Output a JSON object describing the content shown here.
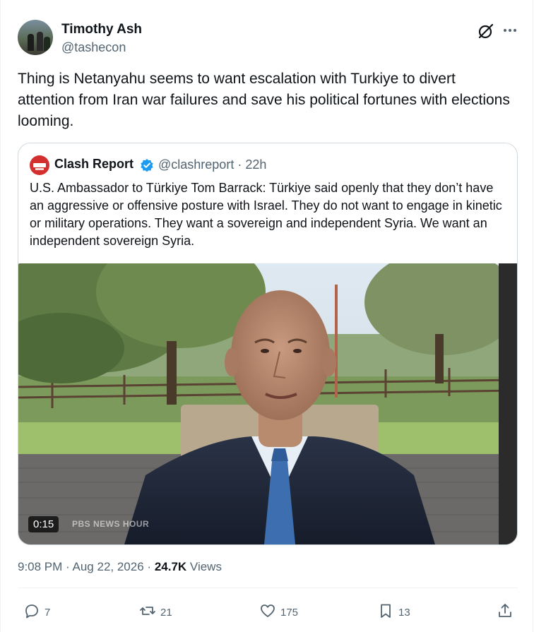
{
  "author": {
    "name": "Timothy Ash",
    "handle": "@tashecon"
  },
  "tweet": {
    "text": "Thing is Netanyahu seems to want escalation with Turkiye to divert attention from Iran war failures and save his political fortunes with elections looming."
  },
  "quoted": {
    "name": "Clash Report",
    "handle": "@clashreport",
    "separator": "·",
    "time": "22h",
    "text": "U.S. Ambassador to Türkiye Tom Barrack: Türkiye said openly that they don’t have an aggressive or offensive posture with Israel.  They do not want to engage in kinetic or military operations. They want a sovereign and independent Syria. We want an independent sovereign Syria.",
    "video": {
      "duration": "0:15",
      "watermark": "PBS NEWS HOUR"
    }
  },
  "meta": {
    "time": "9:08 PM",
    "sep": "·",
    "date": "Aug 22, 2026",
    "views_count": "24.7K",
    "views_label": "Views"
  },
  "actions": {
    "replies": "7",
    "reposts": "21",
    "likes": "175",
    "bookmarks": "13"
  },
  "icons": {
    "header_right": [
      "grok-icon",
      "more-icon"
    ],
    "verified": "verified-badge-icon",
    "actions": [
      "reply-icon",
      "repost-icon",
      "like-icon",
      "bookmark-icon",
      "share-icon"
    ]
  },
  "colors": {
    "text_primary": "#0f1419",
    "text_secondary": "#536471",
    "verified": "#1d9bf0",
    "border": "#cfd9de",
    "quote_avatar": "#d32f2f"
  }
}
